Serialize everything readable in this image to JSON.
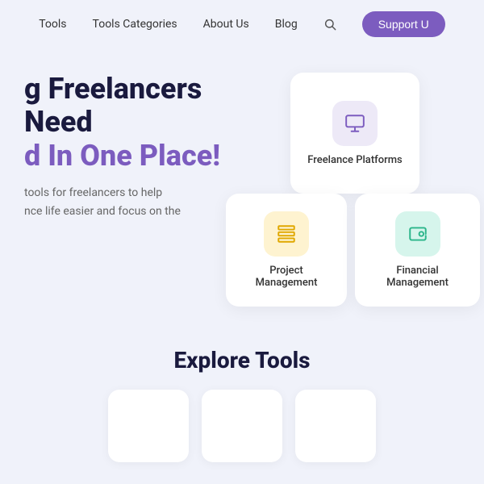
{
  "nav": {
    "links": [
      {
        "id": "tools",
        "label": "Tools"
      },
      {
        "id": "tools-categories",
        "label": "Tools Categories"
      },
      {
        "id": "about-us",
        "label": "About Us"
      },
      {
        "id": "blog",
        "label": "Blog"
      }
    ],
    "support_button": "Support U",
    "search_icon": "search"
  },
  "hero": {
    "title_line1": "g Freelancers Need",
    "title_line2": "d In One Place!",
    "subtitle_line1": "tools for freelancers to help",
    "subtitle_line2": "nce life easier and focus on the"
  },
  "cards": [
    {
      "id": "freelance-platforms",
      "label": "Freelance Platforms",
      "icon": "laptop",
      "icon_bg": "#ede9f7",
      "icon_color": "#7c5cbf"
    },
    {
      "id": "project-management",
      "label": "Project Management",
      "icon": "layers",
      "icon_bg": "#fef3d0",
      "icon_color": "#e0a800"
    },
    {
      "id": "financial-management",
      "label": "Financial Management",
      "icon": "wallet",
      "icon_bg": "#d6f5ec",
      "icon_color": "#2bb58a"
    }
  ],
  "explore": {
    "title": "Explore Tools"
  }
}
